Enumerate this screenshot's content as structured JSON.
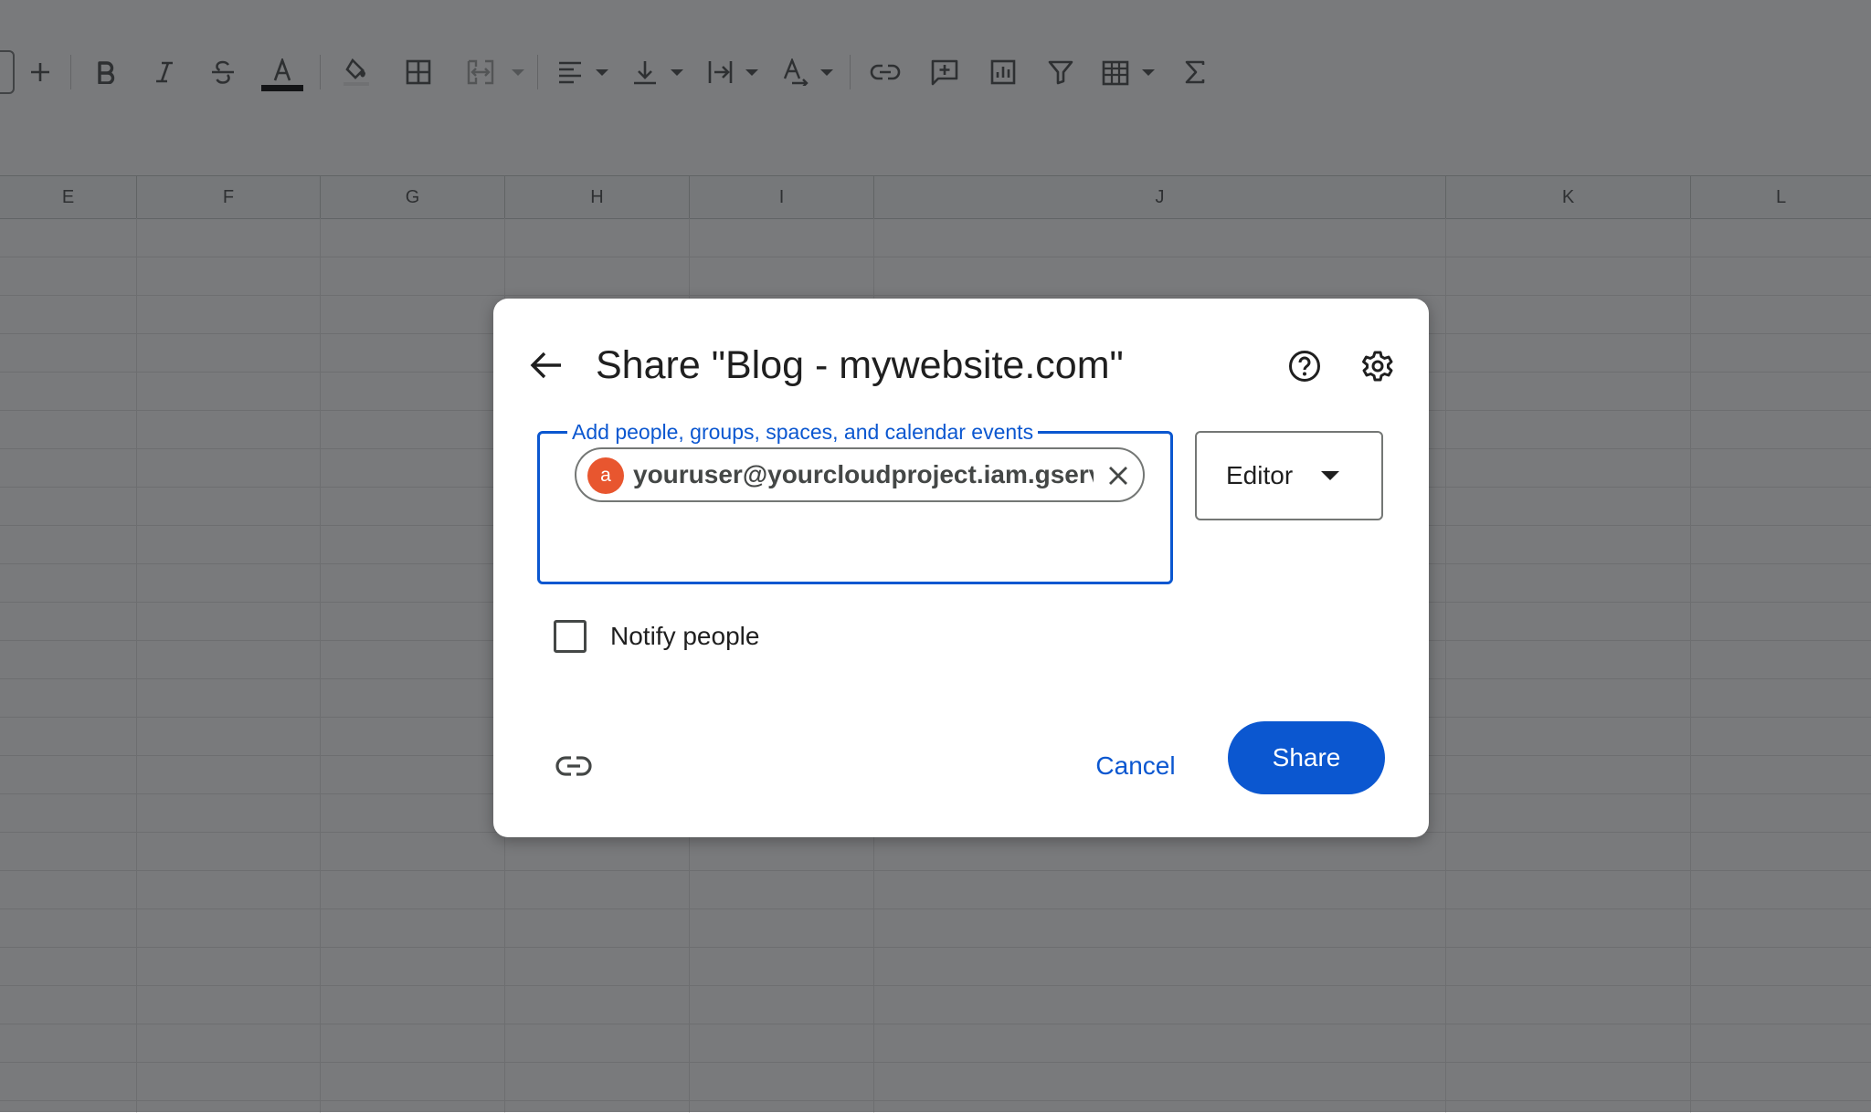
{
  "toolbar": {
    "icons": [
      "zoom-control-edge",
      "add-icon",
      "bold-icon",
      "italic-icon",
      "strikethrough-icon",
      "text-color-icon",
      "fill-color-icon",
      "borders-icon",
      "merge-cells-icon",
      "horizontal-align-icon",
      "vertical-align-icon",
      "text-wrapping-icon",
      "text-rotation-icon",
      "insert-link-icon",
      "insert-comment-icon",
      "insert-chart-icon",
      "filter-icon",
      "filter-views-icon",
      "functions-icon"
    ],
    "text_color": "#000000"
  },
  "sheet": {
    "columns": [
      "E",
      "F",
      "G",
      "H",
      "I",
      "J",
      "K",
      "L"
    ]
  },
  "dialog": {
    "title": "Share \"Blog - mywebsite.com\"",
    "people_field": {
      "label": "Add people, groups, spaces, and calendar events",
      "chip": {
        "avatar_letter": "a",
        "avatar_color": "#e8562f",
        "email": "youruser@yourcloudproject.iam.gservi"
      }
    },
    "role": {
      "selected": "Editor"
    },
    "notify": {
      "label": "Notify people",
      "checked": false
    },
    "buttons": {
      "cancel": "Cancel",
      "share": "Share"
    },
    "accent_color": "#0b57d0"
  }
}
